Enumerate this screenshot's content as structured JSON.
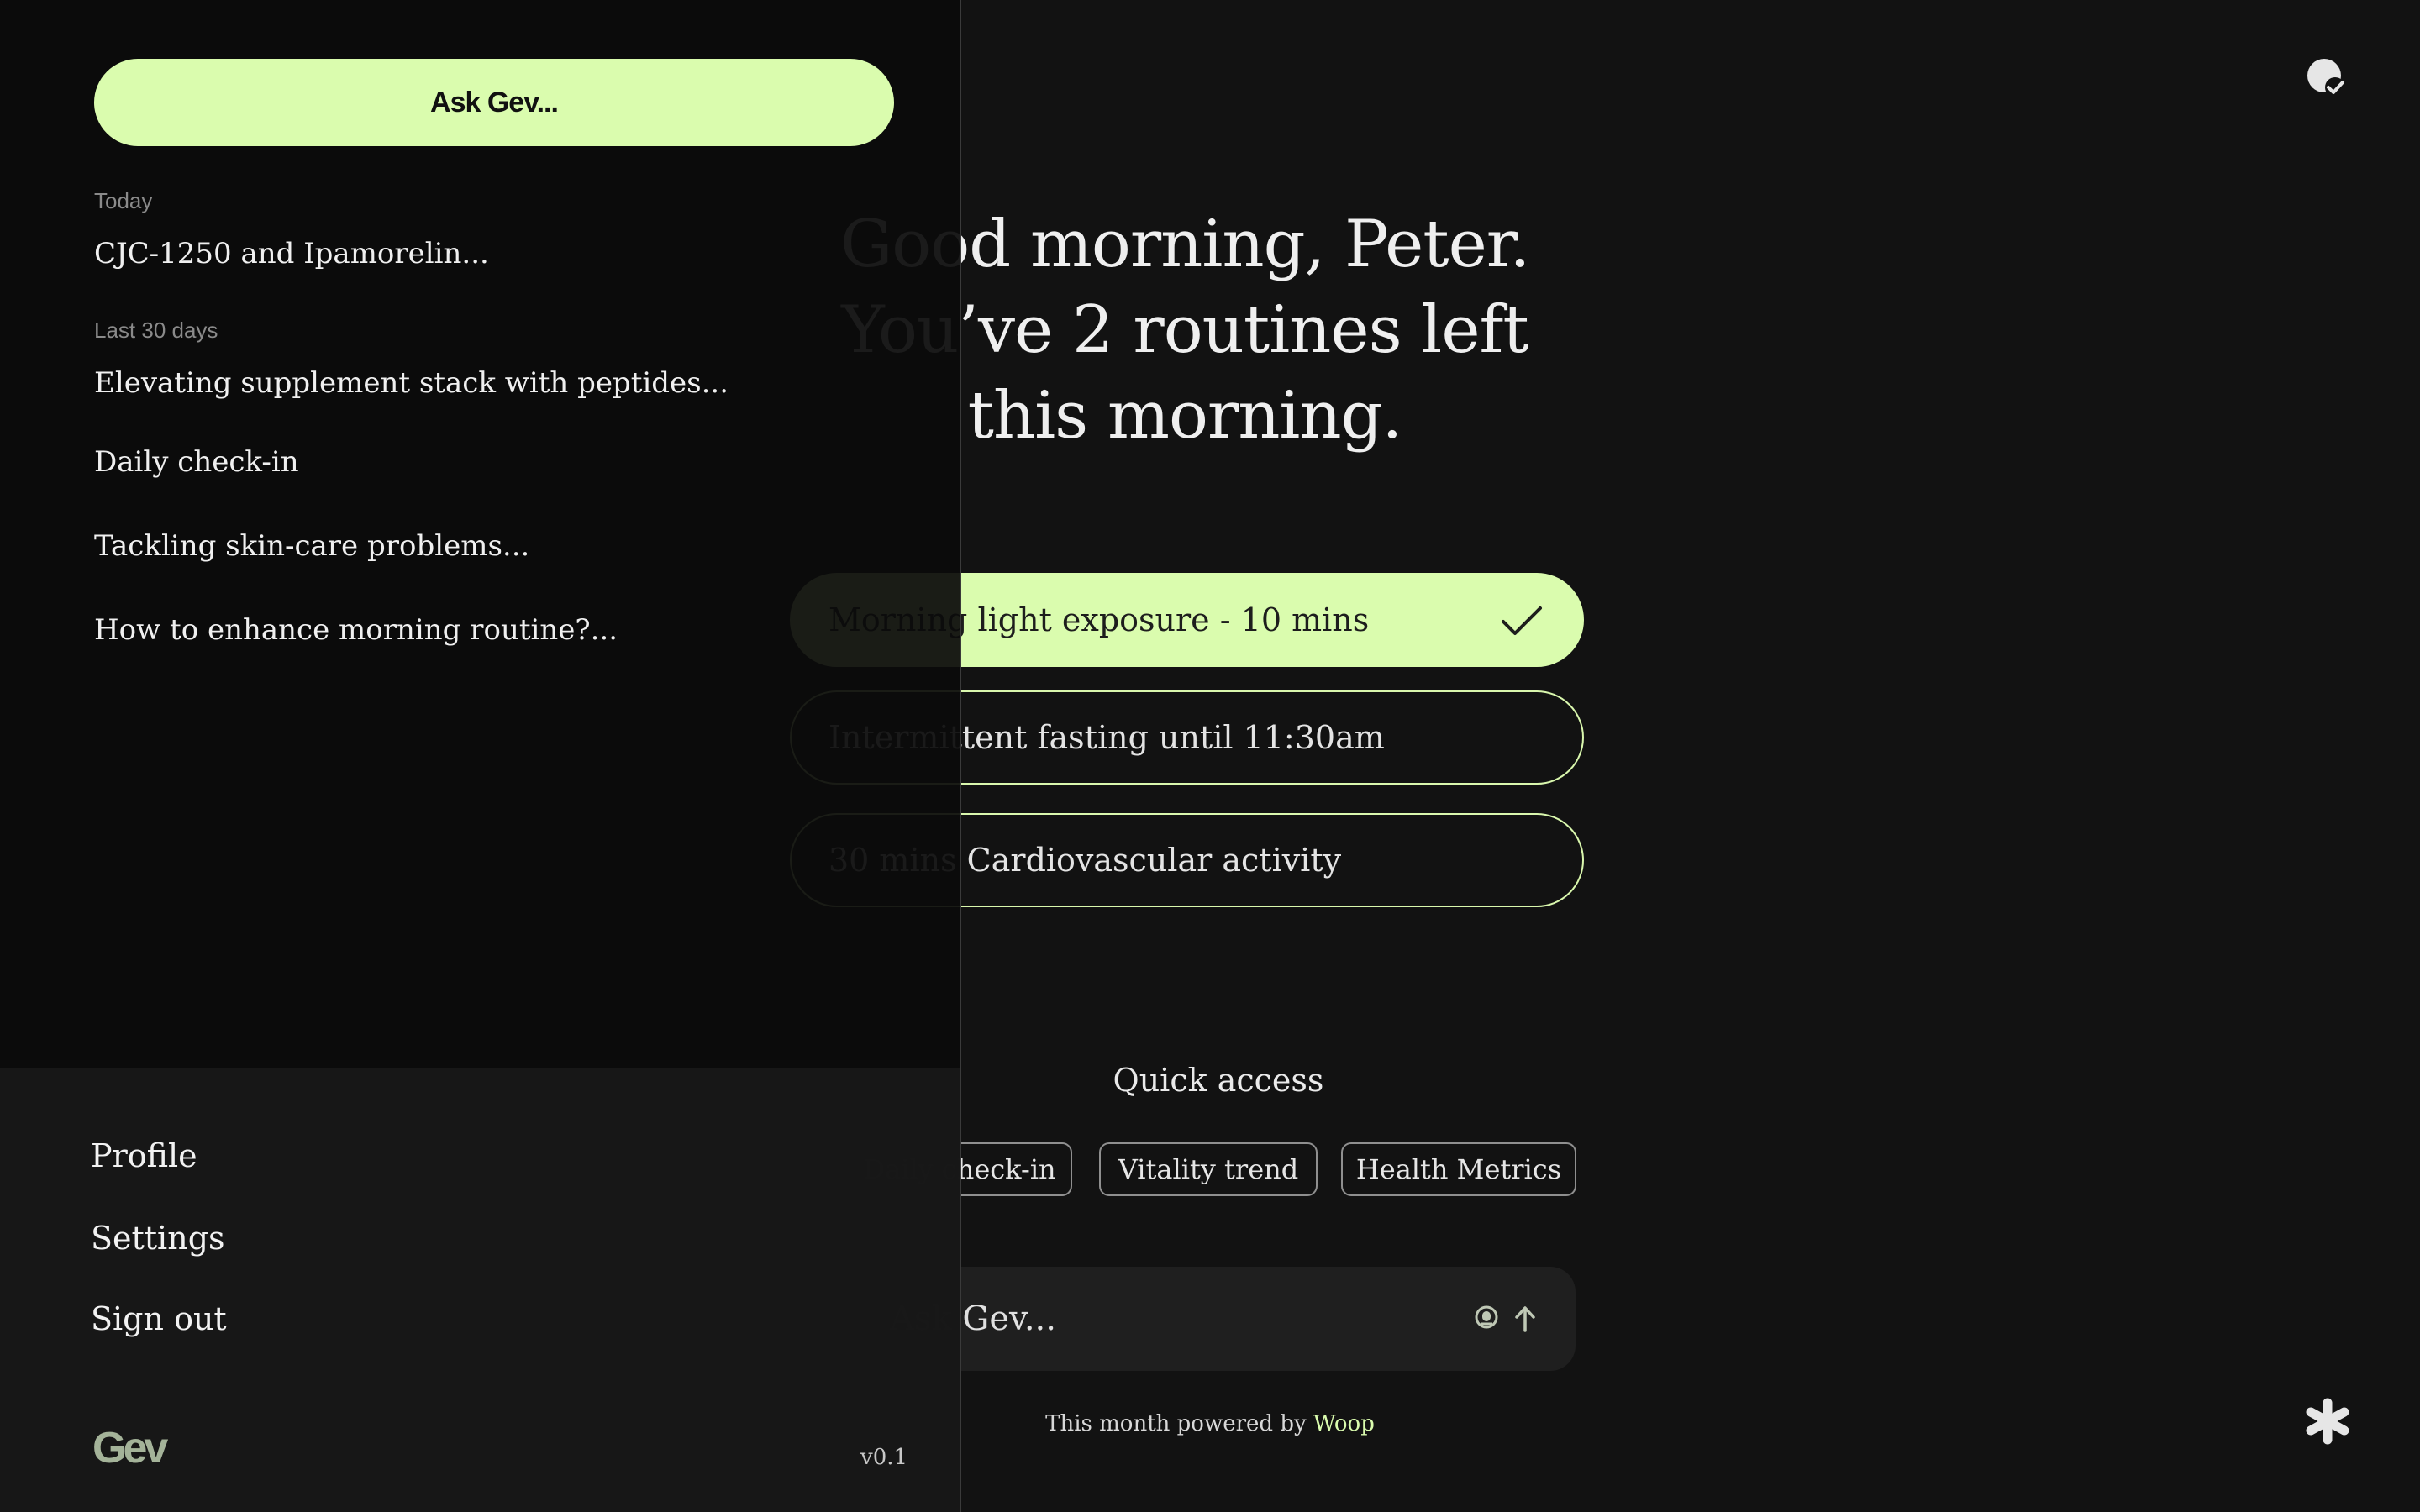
{
  "main": {
    "greeting_lines": [
      "Good morning, Peter.",
      "You’ve 2 routines left",
      "this morning."
    ],
    "routines": [
      {
        "label": "Morning light exposure - 10 mins",
        "done": true
      },
      {
        "label": "Intermittent fasting until 11:30am",
        "done": false
      },
      {
        "label": "30 mins Cardiovascular activity",
        "done": false
      }
    ],
    "quick_access": {
      "title": "Quick access",
      "chips": [
        "Daily check-in",
        "Vitality trend",
        "Health Metrics"
      ]
    },
    "ask_box": {
      "placeholder": "Ask Gev..."
    },
    "footer": {
      "prefix": "This month powered by",
      "brand": "Woop"
    },
    "colors": {
      "accent": "#dafcae",
      "background": "#121212"
    },
    "icons": {
      "profile": "user-check-icon",
      "asterisk": "asterisk-icon",
      "mic": "microphone-icon",
      "send": "arrow-up-icon",
      "check": "check-icon"
    }
  },
  "drawer": {
    "ask_button": "Ask Gev...",
    "sections": [
      {
        "label": "Today",
        "items": [
          "CJC-1250 and Ipamorelin..."
        ]
      },
      {
        "label": "Last 30 days",
        "items": [
          "Elevating supplement stack with peptides...",
          "Daily check-in",
          "Tackling skin-care problems...",
          "How to enhance morning routine?..."
        ]
      }
    ],
    "menu": [
      "Profile",
      "Settings",
      "Sign out"
    ],
    "logo": "Gev",
    "version": "v0.1"
  }
}
